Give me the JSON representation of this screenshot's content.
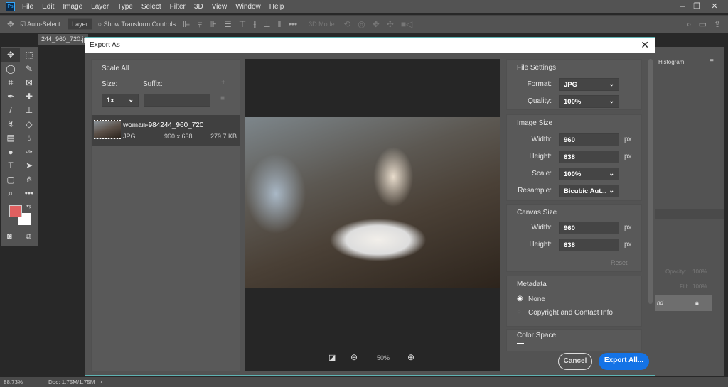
{
  "app": {
    "logo": "Ps",
    "menu": [
      "File",
      "Edit",
      "Image",
      "Layer",
      "Type",
      "Select",
      "Filter",
      "3D",
      "View",
      "Window",
      "Help"
    ]
  },
  "options": {
    "auto_select_label": "Auto-Select:",
    "auto_select_value": "Layer",
    "show_transform": "Show Transform Controls",
    "mode_3d": "3D Mode:"
  },
  "document_tab": "244_960_720.jpg",
  "colors": {
    "foreground": "#e06060",
    "background": "#ffffff",
    "accent": "#1473e6"
  },
  "dialog": {
    "title": "Export As",
    "scale_all": {
      "heading": "Scale All",
      "size_label": "Size:",
      "suffix_label": "Suffix:",
      "size_value": "1x",
      "suffix_value": ""
    },
    "asset": {
      "name": "woman-984244_960_720",
      "format": "JPG",
      "dimensions": "960 x 638",
      "filesize": "279.7 KB"
    },
    "preview": {
      "zoom": "50%"
    },
    "file_settings": {
      "heading": "File Settings",
      "format_label": "Format:",
      "format_value": "JPG",
      "quality_label": "Quality:",
      "quality_value": "100%"
    },
    "image_size": {
      "heading": "Image Size",
      "width_label": "Width:",
      "width_value": "960",
      "height_label": "Height:",
      "height_value": "638",
      "unit": "px",
      "scale_label": "Scale:",
      "scale_value": "100%",
      "resample_label": "Resample:",
      "resample_value": "Bicubic Aut..."
    },
    "canvas_size": {
      "heading": "Canvas Size",
      "width_label": "Width:",
      "width_value": "960",
      "height_label": "Height:",
      "height_value": "638",
      "unit": "px",
      "reset": "Reset"
    },
    "metadata": {
      "heading": "Metadata",
      "options": [
        "None",
        "Copyright and Contact Info"
      ],
      "selected": "None"
    },
    "color_space": {
      "heading": "Color Space"
    },
    "cancel": "Cancel",
    "export": "Export All..."
  },
  "panels": {
    "histogram": "Histogram",
    "opacity_label": "Opacity:",
    "opacity_value": "100%",
    "fill_label": "Fill:",
    "fill_value": "100%",
    "layer_name": "nd"
  },
  "status": {
    "zoom": "88.73%",
    "doc": "Doc: 1.75M/1.75M"
  }
}
